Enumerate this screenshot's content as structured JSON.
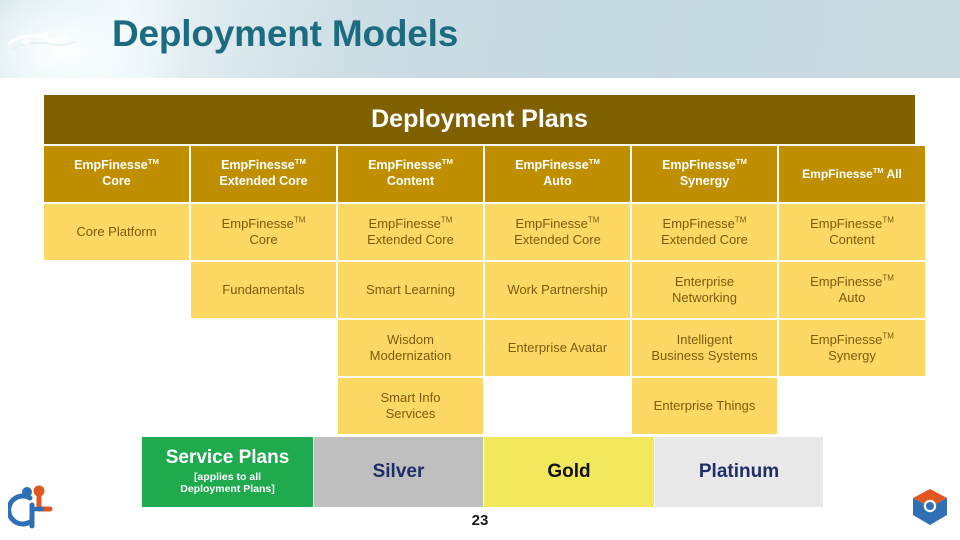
{
  "header": {
    "title": "Deployment Models",
    "title_color": "#1c6b80",
    "deco_icon": "abstract-swoosh-icon"
  },
  "table": {
    "banner_title": "Deployment Plans",
    "banner_color": "#806000",
    "header_color": "#bf8f00",
    "body_color": "#fcd965",
    "columns": [
      {
        "line1": "EmpFinesse",
        "tm": "TM",
        "line2": "Core"
      },
      {
        "line1": "EmpFinesse",
        "tm": "TM",
        "line2": "Extended Core"
      },
      {
        "line1": "EmpFinesse",
        "tm": "TM",
        "line2": "Content"
      },
      {
        "line1": "EmpFinesse",
        "tm": "TM",
        "line2": "Auto"
      },
      {
        "line1": "EmpFinesse",
        "tm": "TM",
        "line2": "Synergy"
      },
      {
        "line1": "EmpFinesse",
        "tm": "TM",
        "line2": "All",
        "inline": true
      }
    ],
    "rows": [
      {
        "cells": [
          {
            "text": "Core Platform",
            "filled": true
          },
          {
            "line1": "EmpFinesse",
            "tm": "TM",
            "line2": "Core",
            "filled": true
          },
          {
            "line1": "EmpFinesse",
            "tm": "TM",
            "line2": "Extended Core",
            "filled": true
          },
          {
            "line1": "EmpFinesse",
            "tm": "TM",
            "line2": "Extended Core",
            "filled": true
          },
          {
            "line1": "EmpFinesse",
            "tm": "TM",
            "line2": "Extended Core",
            "filled": true
          },
          {
            "line1": "EmpFinesse",
            "tm": "TM",
            "line2": "Content",
            "filled": true
          }
        ]
      },
      {
        "cells": [
          {
            "text": "",
            "filled": false
          },
          {
            "text": "Fundamentals",
            "filled": true
          },
          {
            "text": "Smart Learning",
            "filled": true
          },
          {
            "text": "Work Partnership",
            "filled": true
          },
          {
            "line1": "Enterprise",
            "line2": "Networking",
            "filled": true
          },
          {
            "line1": "EmpFinesse",
            "tm": "TM",
            "line2": "Auto",
            "filled": true
          }
        ]
      },
      {
        "cells": [
          {
            "text": "",
            "filled": false
          },
          {
            "text": "",
            "filled": false
          },
          {
            "line1": "Wisdom",
            "line2": "Modernization",
            "filled": true
          },
          {
            "text": "Enterprise Avatar",
            "filled": true
          },
          {
            "line1": "Intelligent",
            "line2": "Business Systems",
            "filled": true
          },
          {
            "line1": "EmpFinesse",
            "tm": "TM",
            "line2": "Synergy",
            "filled": true
          }
        ]
      },
      {
        "cells": [
          {
            "text": "",
            "filled": false
          },
          {
            "text": "",
            "filled": false
          },
          {
            "line1": "Smart Info",
            "line2": "Services",
            "filled": true
          },
          {
            "text": "",
            "filled": false
          },
          {
            "text": "Enterprise Things",
            "filled": true
          },
          {
            "text": "",
            "filled": false
          }
        ]
      }
    ]
  },
  "service_plans": {
    "label_title": "Service Plans",
    "label_sub_line1": "[applies to all",
    "label_sub_line2": "Deployment Plans]",
    "label_color": "#1faa4e",
    "tiers": [
      {
        "name": "Silver",
        "color": "#bfbfbf",
        "text_color": "#1f2d68"
      },
      {
        "name": "Gold",
        "color": "#f2e85c",
        "text_color": "#111111"
      },
      {
        "name": "Platinum",
        "color": "#e8e8e8",
        "text_color": "#1f2d68"
      }
    ]
  },
  "footer": {
    "page_number": "23",
    "left_logo": "people-accessibility-logo-icon",
    "right_logo": "hexagon-cube-logo-icon"
  }
}
